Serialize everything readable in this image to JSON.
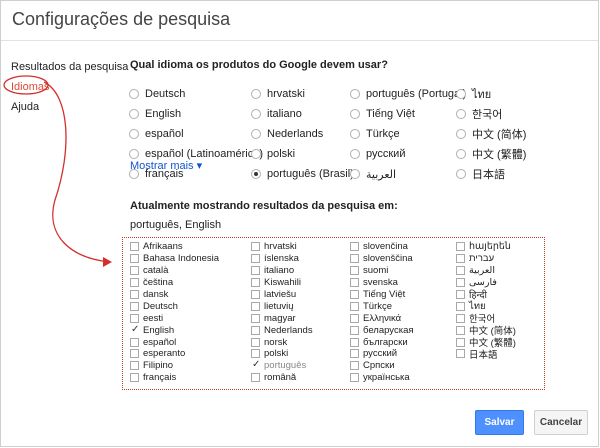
{
  "title": "Configurações de pesquisa",
  "sidebar": {
    "items": [
      {
        "label": "Resultados da pesquisa"
      },
      {
        "label": "Idiomas"
      },
      {
        "label": "Ajuda"
      }
    ]
  },
  "product_language": {
    "heading": "Qual idioma os produtos do Google devem usar?",
    "columns": [
      [
        "Deutsch",
        "English",
        "español",
        "español (Latinoamérica)",
        "français"
      ],
      [
        "hrvatski",
        "italiano",
        "Nederlands",
        "polski",
        "português (Brasil)"
      ],
      [
        "português (Portugal)",
        "Tiếng Việt",
        "Türkçe",
        "русский",
        "العربية"
      ],
      [
        "ไทย",
        "한국어",
        "中文 (简体)",
        "中文 (繁體)",
        "日本語"
      ]
    ],
    "selected": "português (Brasil)",
    "more_link": "Mostrar mais ▾"
  },
  "search_languages": {
    "heading": "Atualmente mostrando resultados da pesquisa em:",
    "current": "português, English",
    "columns": [
      [
        "Afrikaans",
        "Bahasa Indonesia",
        "català",
        "čeština",
        "dansk",
        "Deutsch",
        "eesti",
        "English",
        "español",
        "esperanto",
        "Filipino",
        "français"
      ],
      [
        "hrvatski",
        "íslenska",
        "italiano",
        "Kiswahili",
        "latviešu",
        "lietuvių",
        "magyar",
        "Nederlands",
        "norsk",
        "polski",
        "português",
        "română"
      ],
      [
        "slovenčina",
        "slovenščina",
        "suomi",
        "svenska",
        "Tiếng Việt",
        "Türkçe",
        "Ελληνικά",
        "беларуская",
        "български",
        "русский",
        "Српски",
        "українська"
      ],
      [
        "հայերեն",
        "עברית",
        "العربية",
        "فارسی",
        "हिन्दी",
        "ไทย",
        "한국어",
        "中文 (简体)",
        "中文 (繁體)",
        "日本語"
      ]
    ],
    "checked": [
      "English",
      "português"
    ],
    "dimmed": [
      "português"
    ]
  },
  "buttons": {
    "save": "Salvar",
    "cancel": "Cancelar"
  },
  "colors": {
    "accent_red": "#dd4b39",
    "link_blue": "#1155cc",
    "save_blue": "#4d90fe",
    "annotation_red": "#c0392b"
  }
}
